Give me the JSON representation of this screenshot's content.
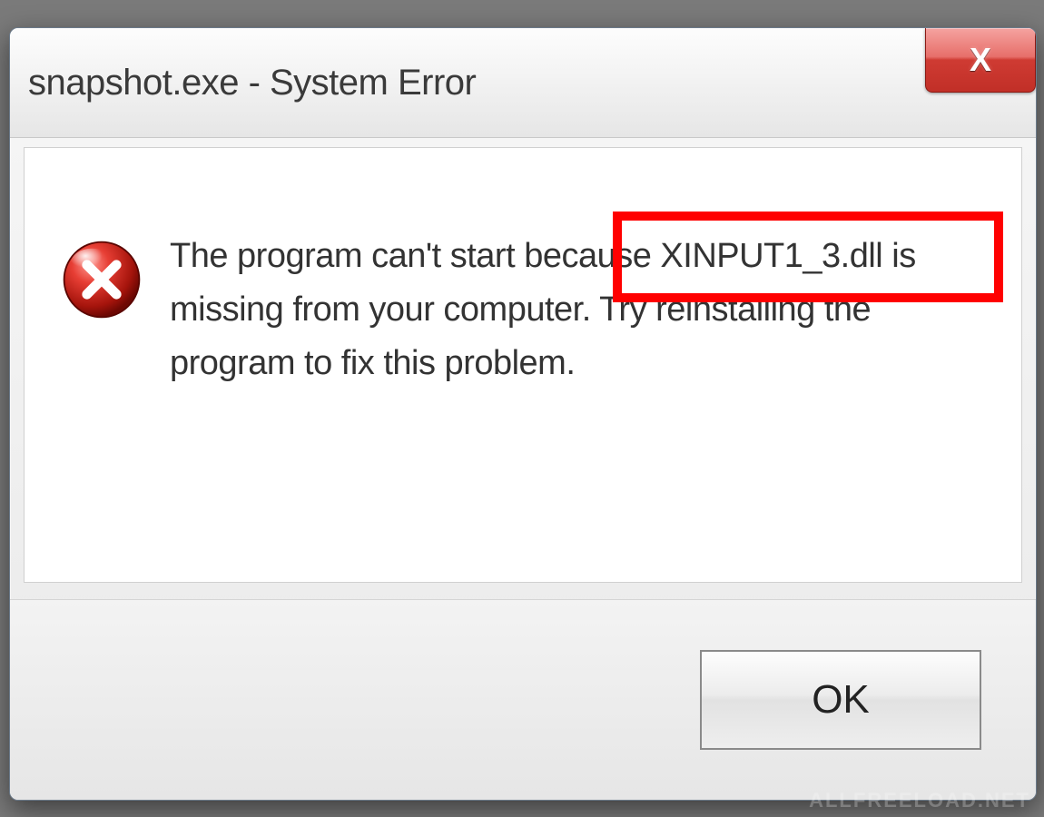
{
  "dialog": {
    "title": "snapshot.exe - System Error",
    "close_label": "X",
    "message": "The program can't start because XINPUT1_3.dll is missing from your computer. Try reinstalling the program to fix this problem.",
    "highlighted_phrase": "XINPUT1_3.dll is missing",
    "ok_label": "OK",
    "icon": "error-x-icon"
  },
  "annotation": {
    "highlight_color": "#ff0000"
  },
  "watermark": "ALLFREELOAD.NET"
}
